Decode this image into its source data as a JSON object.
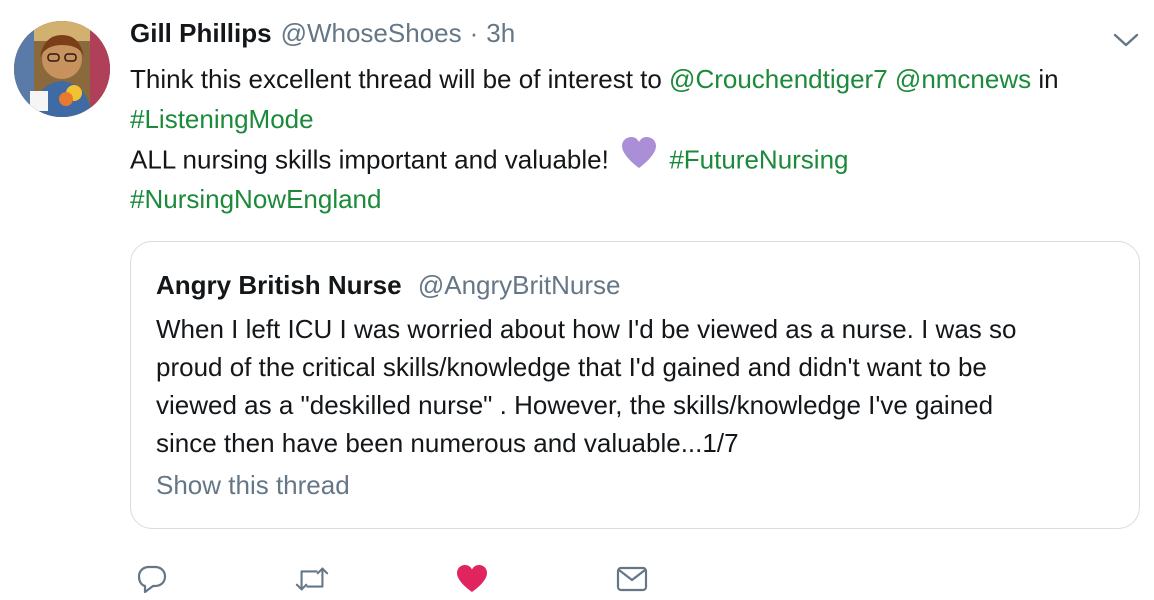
{
  "tweet": {
    "author_name": "Gill Phillips",
    "author_handle": "@WhoseShoes",
    "separator": "·",
    "time": "3h",
    "line1": {
      "text_a": "Think this excellent thread will be of interest to ",
      "mention_1": "@Crouchendtiger7",
      "space": " ",
      "mention_2": "@nmcnews",
      "text_b": " in"
    },
    "line2": {
      "hashtag": "#ListeningMode"
    },
    "line3": {
      "text": "ALL nursing skills important and valuable! ",
      "emoji": "purple-heart",
      "hashtag": "#FutureNursing"
    },
    "line4": {
      "hashtag": "#NursingNowEngland"
    }
  },
  "quoted_tweet": {
    "author_name": "Angry British Nurse",
    "author_handle": "@AngryBritNurse",
    "lines": [
      "When I left ICU I was worried about how I'd be viewed as a nurse. I was so",
      "proud of the critical skills/knowledge that I'd gained and didn't want to be",
      "viewed as a \"deskilled nurse\" . However, the skills/knowledge I've gained",
      "since then have been numerous and valuable...1/7"
    ],
    "show_thread": "Show this thread"
  },
  "actions": {
    "reply": "reply-icon",
    "retweet": "retweet-icon",
    "like": "heart-icon",
    "message": "mail-icon"
  },
  "colors": {
    "link": "#1b8a3a",
    "muted": "#657786",
    "text": "#14171a",
    "like": "#e0245e",
    "border": "#d6dde3",
    "emoji_heart": "#aa8ed6"
  }
}
